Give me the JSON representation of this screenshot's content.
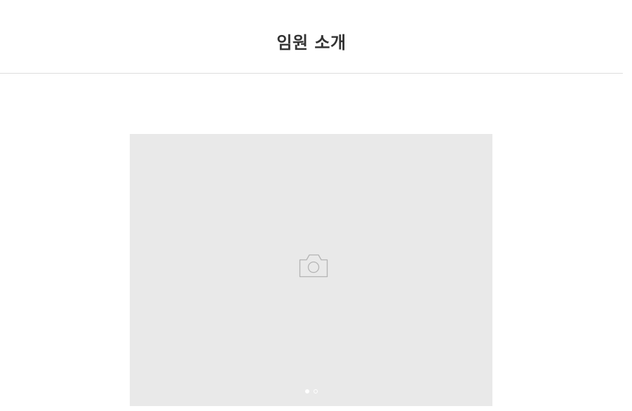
{
  "header": {
    "title": "임원 소개"
  },
  "gallery": {
    "image_icon": "camera-icon",
    "placeholder_color": "#e9e9e9",
    "pagination": {
      "current": 1,
      "total": 2
    }
  }
}
